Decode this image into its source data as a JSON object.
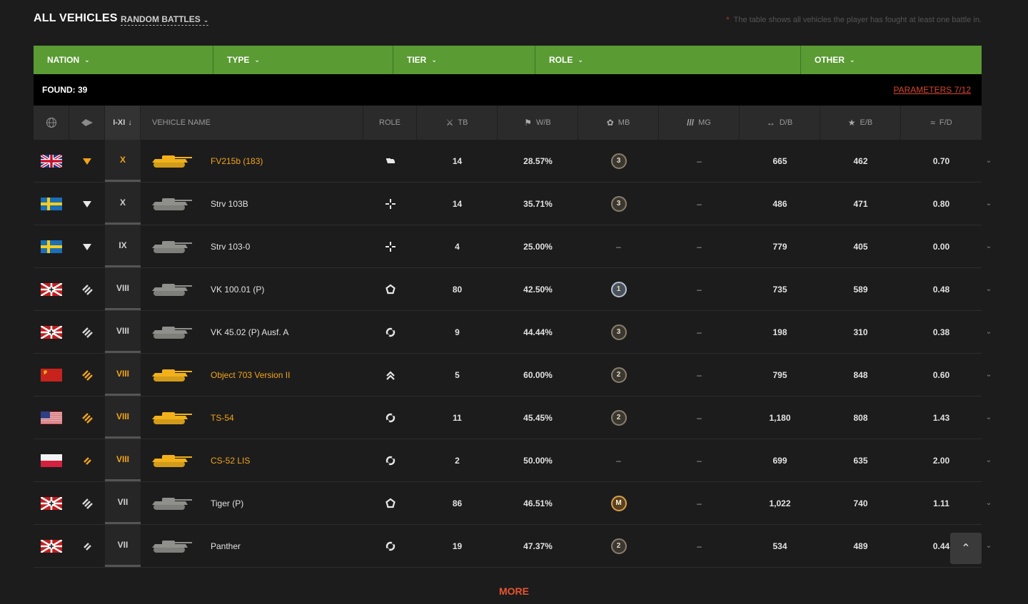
{
  "header": {
    "title": "ALL VEHICLES",
    "mode": "RANDOM BATTLES",
    "note_star": "*",
    "note": "The table shows all vehicles the player has fought at least one battle in."
  },
  "filters": [
    {
      "label": "NATION"
    },
    {
      "label": "TYPE"
    },
    {
      "label": "TIER"
    },
    {
      "label": "ROLE"
    },
    {
      "label": "OTHER"
    }
  ],
  "found": {
    "label": "FOUND: 39",
    "params": "PARAMETERS 7/12"
  },
  "columns": {
    "tier": "I-XI",
    "name": "VEHICLE NAME",
    "role": "ROLE",
    "tb": "TB",
    "wb": "W/B",
    "mb": "MB",
    "mg": "MG",
    "db": "D/B",
    "eb": "E/B",
    "fd": "F/D"
  },
  "rows": [
    {
      "nation": "uk",
      "type": "spg",
      "tier": "X",
      "name": "FV215b (183)",
      "premium": true,
      "role_icon": "tank-destroyer-role-icon",
      "tb": "14",
      "wb": "28.57%",
      "mb": "3",
      "mg": "–",
      "db": "665",
      "eb": "462",
      "fd": "0.70"
    },
    {
      "nation": "sweden",
      "type": "td",
      "tier": "X",
      "name": "Strv 103B",
      "premium": false,
      "role_icon": "sniper-role-icon",
      "tb": "14",
      "wb": "35.71%",
      "mb": "3",
      "mg": "–",
      "db": "486",
      "eb": "471",
      "fd": "0.80"
    },
    {
      "nation": "sweden",
      "type": "td",
      "tier": "IX",
      "name": "Strv 103-0",
      "premium": false,
      "role_icon": "sniper-role-icon",
      "tb": "4",
      "wb": "25.00%",
      "mb": "–",
      "mg": "–",
      "db": "779",
      "eb": "405",
      "fd": "0.00"
    },
    {
      "nation": "germany",
      "type": "heavy",
      "tier": "VIII",
      "name": "VK 100.01 (P)",
      "premium": false,
      "role_icon": "assault-role-icon",
      "tb": "80",
      "wb": "42.50%",
      "mb": "1",
      "mg": "–",
      "db": "735",
      "eb": "589",
      "fd": "0.48"
    },
    {
      "nation": "germany",
      "type": "heavy",
      "tier": "VIII",
      "name": "VK 45.02 (P) Ausf. A",
      "premium": false,
      "role_icon": "versatile-role-icon",
      "tb": "9",
      "wb": "44.44%",
      "mb": "3",
      "mg": "–",
      "db": "198",
      "eb": "310",
      "fd": "0.38"
    },
    {
      "nation": "ussr",
      "type": "heavy",
      "tier": "VIII",
      "name": "Object 703 Version II",
      "premium": true,
      "role_icon": "breakthrough-role-icon",
      "tb": "5",
      "wb": "60.00%",
      "mb": "2",
      "mg": "–",
      "db": "795",
      "eb": "848",
      "fd": "0.60"
    },
    {
      "nation": "usa",
      "type": "heavy",
      "tier": "VIII",
      "name": "TS-54",
      "premium": true,
      "role_icon": "versatile-role-icon",
      "tb": "11",
      "wb": "45.45%",
      "mb": "2",
      "mg": "–",
      "db": "1,180",
      "eb": "808",
      "fd": "1.43"
    },
    {
      "nation": "poland",
      "type": "medium",
      "tier": "VIII",
      "name": "CS-52 LIS",
      "premium": true,
      "role_icon": "versatile-role-icon",
      "tb": "2",
      "wb": "50.00%",
      "mb": "–",
      "mg": "–",
      "db": "699",
      "eb": "635",
      "fd": "2.00"
    },
    {
      "nation": "germany",
      "type": "heavy",
      "tier": "VII",
      "name": "Tiger (P)",
      "premium": false,
      "role_icon": "assault-role-icon",
      "tb": "86",
      "wb": "46.51%",
      "mb": "M",
      "mg": "–",
      "db": "1,022",
      "eb": "740",
      "fd": "1.11"
    },
    {
      "nation": "germany",
      "type": "medium",
      "tier": "VII",
      "name": "Panther",
      "premium": false,
      "role_icon": "versatile-role-icon",
      "tb": "19",
      "wb": "47.37%",
      "mb": "2",
      "mg": "–",
      "db": "534",
      "eb": "489",
      "fd": "0.44"
    }
  ],
  "more": "MORE",
  "colors": {
    "accent_green": "#5a9b34",
    "premium_gold": "#f2a419",
    "link_red": "#d9462f",
    "background": "#1c1c1d"
  }
}
